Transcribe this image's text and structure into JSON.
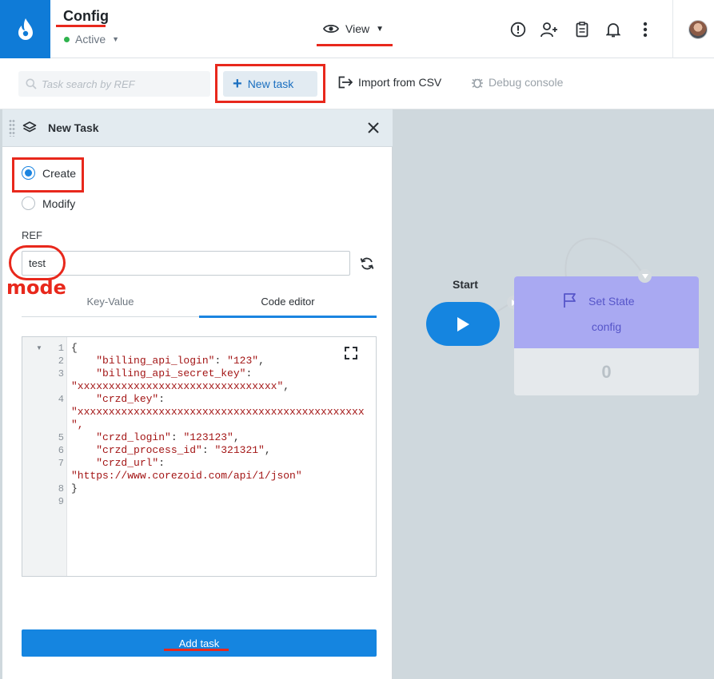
{
  "header": {
    "title": "Config",
    "status": "Active",
    "view_label": "View",
    "icons": [
      "logo-icon",
      "alert-icon",
      "add-user-icon",
      "clipboard-icon",
      "bell-icon",
      "more-icon"
    ]
  },
  "toolbar": {
    "search_placeholder": "Task search by REF",
    "new_task_label": "New task",
    "import_label": "Import from CSV",
    "debug_label": "Debug console"
  },
  "panel": {
    "title": "New Task",
    "radio_create": "Create",
    "radio_modify": "Modify",
    "selected_mode": "Create",
    "ref_label": "REF",
    "ref_value": "test",
    "tabs": [
      {
        "label": "Key-Value",
        "active": false
      },
      {
        "label": "Code editor",
        "active": true
      }
    ],
    "code_lines": [
      {
        "n": "1",
        "text": "{"
      },
      {
        "n": "2",
        "text": "    \"billing_api_login\": \"123\","
      },
      {
        "n": "3",
        "text": "    \"billing_api_secret_key\":"
      },
      {
        "n": "",
        "text": "\"xxxxxxxxxxxxxxxxxxxxxxxxxxxxxxxx\","
      },
      {
        "n": "4",
        "text": "    \"crzd_key\":"
      },
      {
        "n": "",
        "text": "\"xxxxxxxxxxxxxxxxxxxxxxxxxxxxxxxxxxxxxxxxxxxxxx"
      },
      {
        "n": "",
        "text": "\","
      },
      {
        "n": "5",
        "text": "    \"crzd_login\": \"123123\","
      },
      {
        "n": "6",
        "text": "    \"crzd_process_id\": \"321321\","
      },
      {
        "n": "7",
        "text": "    \"crzd_url\":"
      },
      {
        "n": "",
        "text": "\"https://www.corezoid.com/api/1/json\""
      },
      {
        "n": "8",
        "text": "}"
      },
      {
        "n": "9",
        "text": ""
      }
    ],
    "add_task_label": "Add task"
  },
  "canvas": {
    "start_label": "Start",
    "node_title": "Set State",
    "node_subtitle": "config",
    "node_count": "0"
  },
  "annotation": {
    "note": "mode",
    "color": "#e8281c"
  },
  "colors": {
    "brand": "#0f7bd7",
    "accent": "#1585e0",
    "node": "#a9a9f2",
    "status_active": "#2fb34d"
  }
}
